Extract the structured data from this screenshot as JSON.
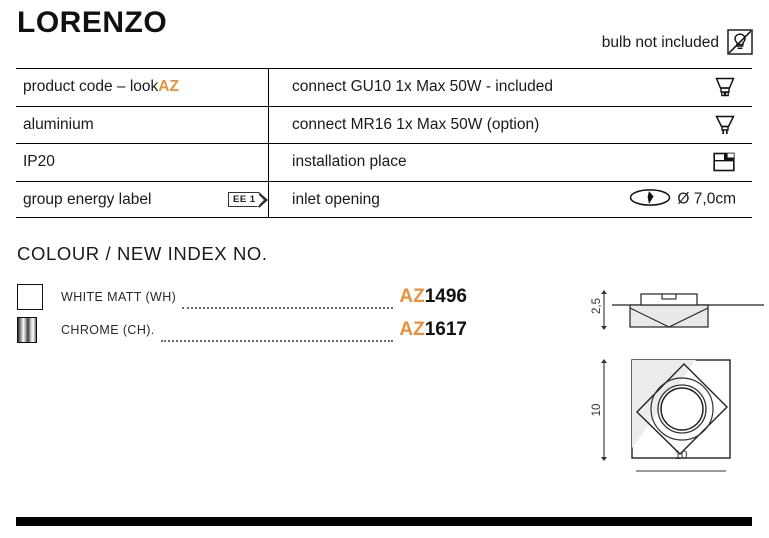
{
  "header": {
    "title": "LORENZO",
    "bulb_note": "bulb not included",
    "bulb_icon": "no-bulb-icon"
  },
  "spec_table": {
    "rows": [
      {
        "left_text": "product code – look ",
        "left_accent": "AZ",
        "right_text": "connect GU10 1x Max 50W - included",
        "right_icon": "gu10-lamp-icon"
      },
      {
        "left_text": "aluminium",
        "left_accent": "",
        "right_text": "connect MR16 1x Max 50W (option)",
        "right_icon": "mr16-lamp-icon"
      },
      {
        "left_text": "IP20",
        "left_accent": "",
        "right_text": "installation place",
        "right_icon": "recessed-ceiling-icon"
      },
      {
        "left_text": "group energy label",
        "left_accent": "",
        "left_badge": "EE 1",
        "right_text": "inlet opening",
        "right_icon": "inlet-opening-icon",
        "right_value": "Ø 7,0cm"
      }
    ]
  },
  "colour_section": {
    "heading": "COLOUR / NEW INDEX NO.",
    "items": [
      {
        "swatch": "white-matt-swatch",
        "name": "WHITE MATT (WH)",
        "code_prefix": "AZ",
        "code_number": "1496"
      },
      {
        "swatch": "chrome-swatch",
        "name": "CHROME (CH).",
        "code_prefix": "AZ",
        "code_number": "1617"
      }
    ]
  },
  "drawings": {
    "side_view": {
      "name": "side-view-drawing",
      "height_label": "2,5"
    },
    "top_view": {
      "name": "top-view-drawing",
      "height_label": "10",
      "width_label": "10"
    }
  },
  "colors": {
    "accent_orange": "#e8923c",
    "line_black": "#000000",
    "text_black": "#1a1a1a"
  }
}
